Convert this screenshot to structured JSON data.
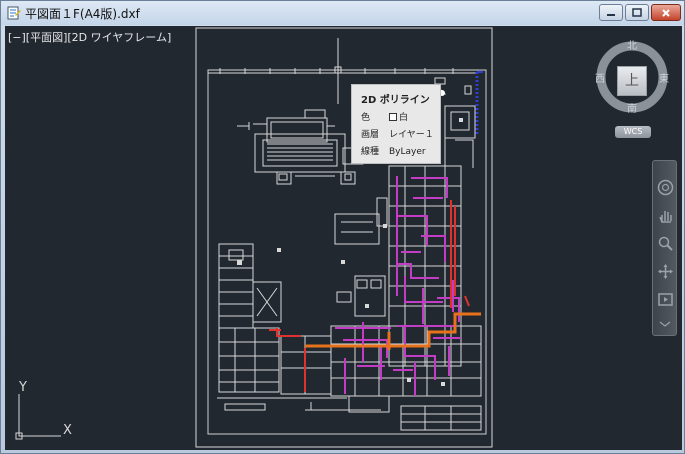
{
  "window": {
    "title": "平図面１F(A4版).dxf",
    "buttons": {
      "minimize": "minimize-icon",
      "maximize": "maximize-icon",
      "close": "close-icon"
    }
  },
  "viewport": {
    "label": "[−][平面図][2D ワイヤフレーム]"
  },
  "tooltip": {
    "title": "2D ポリライン",
    "rows": [
      {
        "key": "色",
        "value": "白"
      },
      {
        "key": "画層",
        "value": "レイヤー１"
      },
      {
        "key": "線種",
        "value": "ByLayer"
      }
    ]
  },
  "viewcube": {
    "north": "北",
    "south": "南",
    "east": "東",
    "west": "西",
    "face": "上",
    "wcs": "WCS"
  },
  "navbar": {
    "icons": [
      "steering-wheel-icon",
      "pan-icon",
      "zoom-icon",
      "orbit-icon",
      "showmotion-icon"
    ]
  },
  "ucs": {
    "x": "X",
    "y": "Y"
  },
  "colors": {
    "viewport_bg": "#212830",
    "linework": "#d8d8d8",
    "magenta": "#c23cc6",
    "red": "#e0322d",
    "orange": "#e8721c",
    "blue": "#2f3fd0"
  }
}
